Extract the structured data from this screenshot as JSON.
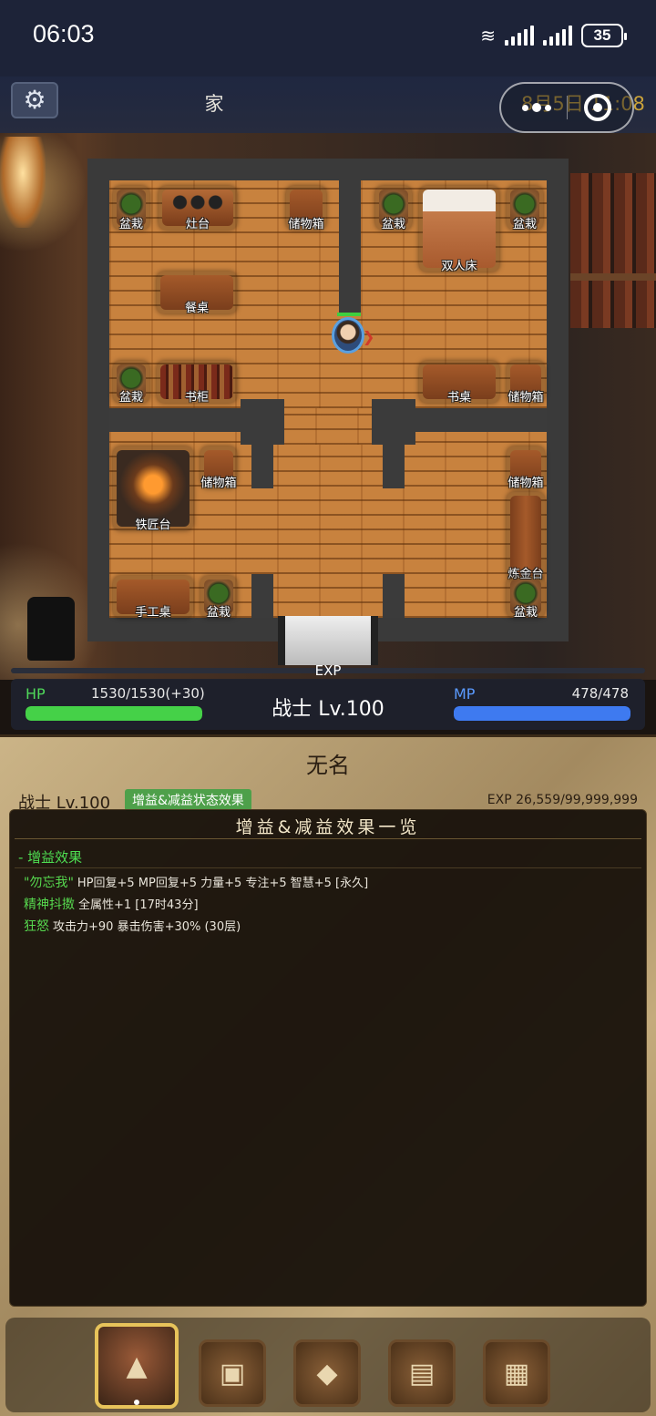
{
  "status_bar": {
    "time": "06:03",
    "battery": "35",
    "network": "6"
  },
  "header": {
    "title": "家",
    "date": "8月5日 11:08"
  },
  "map": {
    "furniture": {
      "plant_1": "盆栽",
      "stove": "灶台",
      "storage_1": "储物箱",
      "plant_2": "盆栽",
      "bed": "双人床",
      "plant_3": "盆栽",
      "table": "餐桌",
      "plant_4": "盆栽",
      "bookshelf": "书柜",
      "desk": "书桌",
      "storage_2": "储物箱",
      "forge": "铁匠台",
      "storage_3": "储物箱",
      "storage_4": "储物箱",
      "alchemy": "炼金台",
      "craft": "手工桌",
      "plant_5": "盆栽",
      "plant_6": "盆栽"
    }
  },
  "stats": {
    "exp_label": "EXP",
    "hp_label": "HP",
    "hp_value": "1530/1530(+30)",
    "hp_fraction": 1.0,
    "class_level": "战士  Lv.100",
    "mp_label": "MP",
    "mp_value": "478/478",
    "mp_fraction": 1.0,
    "colors": {
      "hp": "#45d148",
      "mp": "#3e7af0"
    }
  },
  "character": {
    "name": "无名",
    "class_level": "战士  Lv.100",
    "buff_tag": "增益&减益状态效果",
    "exp": "EXP 26,559/99,999,999"
  },
  "modal": {
    "title": "增益&减益效果一览",
    "section": "- 增益效果",
    "buffs": [
      {
        "name": "\"勿忘我\"",
        "desc": "HP回复+5 MP回复+5 力量+5 专注+5 智慧+5 [永久]"
      },
      {
        "name": "精神抖擞",
        "desc": "全属性+1 [17时43分]"
      },
      {
        "name": "狂怒",
        "desc": "攻击力+90 暴击伤害+30% (30层)"
      }
    ]
  },
  "nav": {
    "items": [
      {
        "icon": "hooded-character-icon",
        "active": true
      },
      {
        "icon": "backpack-icon"
      },
      {
        "icon": "crystal-skill-icon"
      },
      {
        "icon": "book-icon"
      },
      {
        "icon": "map-icon"
      }
    ]
  }
}
